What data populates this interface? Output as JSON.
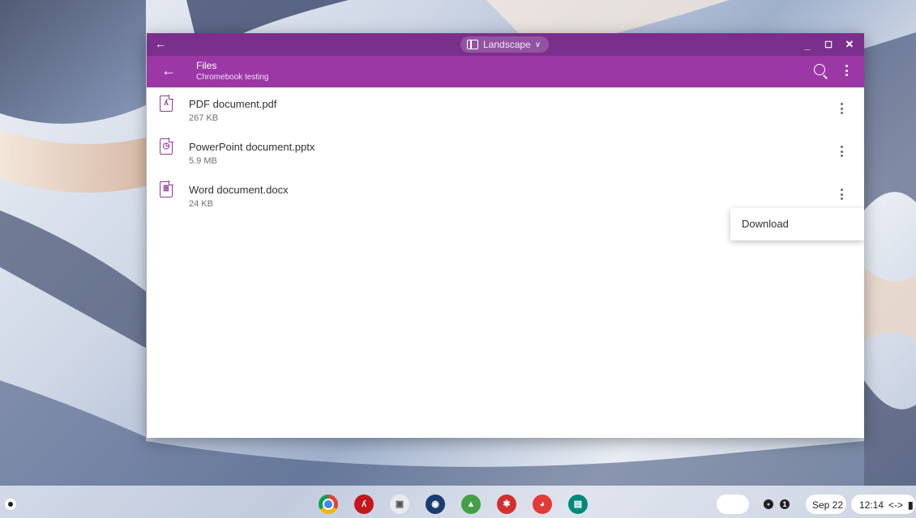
{
  "window": {
    "mode_label": "Landscape",
    "app_title": "Files",
    "app_subtitle": "Chromebook testing"
  },
  "files": [
    {
      "name": "PDF document.pdf",
      "size": "267 KB",
      "icon": "pdf-file-icon"
    },
    {
      "name": "PowerPoint document.pptx",
      "size": "5.9 MB",
      "icon": "presentation-file-icon"
    },
    {
      "name": "Word document.docx",
      "size": "24 KB",
      "icon": "document-file-icon"
    }
  ],
  "context_menu": {
    "items": [
      {
        "label": "Download"
      }
    ]
  },
  "shelf": {
    "apps": [
      {
        "name": "chrome-icon",
        "color": "#4285f4"
      },
      {
        "name": "acrobat-icon",
        "color": "#c4161c"
      },
      {
        "name": "gallery-icon",
        "color": "#e8eaed"
      },
      {
        "name": "vpn-app-icon",
        "color": "#1a3c6e"
      },
      {
        "name": "security-app-icon",
        "color": "#43a047"
      },
      {
        "name": "helm-app-icon",
        "color": "#d32f2f"
      },
      {
        "name": "paint-app-icon",
        "color": "#e53935"
      },
      {
        "name": "id-card-app-icon",
        "color": "#00897b"
      }
    ],
    "date": "Sep 22",
    "time": "12:14"
  },
  "colors": {
    "title_bar": "#7b2f8c",
    "toolbar": "#9c38a6",
    "icon_accent": "#8e3a9a"
  }
}
